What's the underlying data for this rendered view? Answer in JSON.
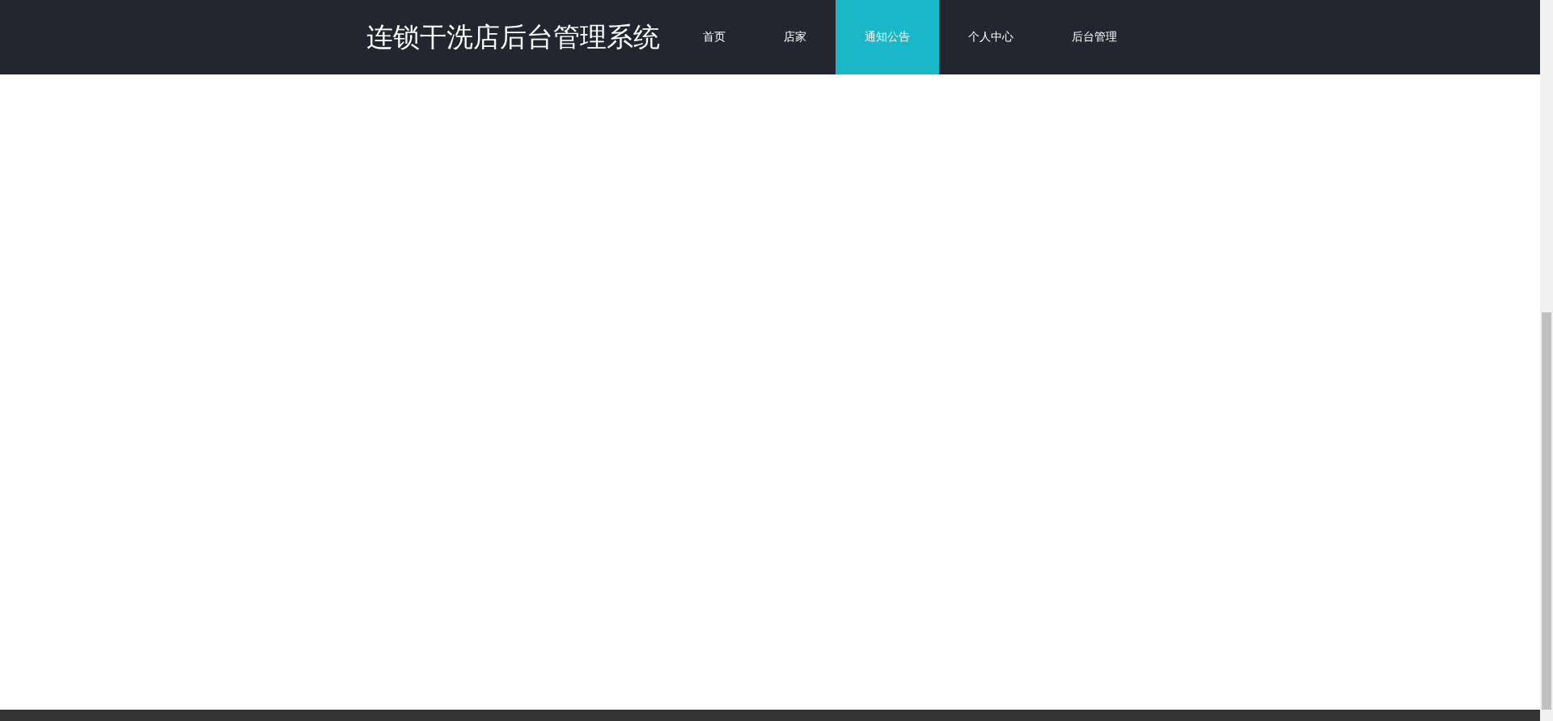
{
  "header": {
    "title": "连锁干洗店后台管理系统"
  },
  "nav": [
    {
      "label": "首页",
      "selected": false
    },
    {
      "label": "店家",
      "selected": false
    },
    {
      "label": "通知公告",
      "selected": true
    },
    {
      "label": "个人中心",
      "selected": false
    },
    {
      "label": "后台管理",
      "selected": false
    }
  ]
}
